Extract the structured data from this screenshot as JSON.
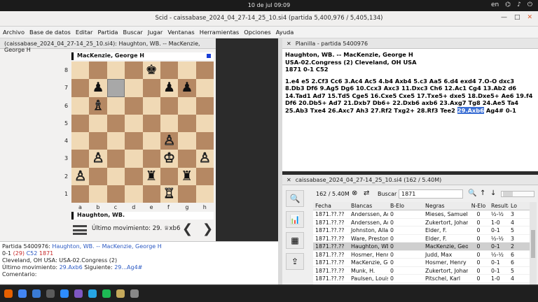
{
  "system": {
    "clock": "10 de jul  09:09",
    "lang": "en",
    "icons": [
      "network-icon",
      "volume-icon",
      "power-icon"
    ]
  },
  "window": {
    "title": "Scid - caissabase_2024_04_27-14_25_10.si4 (partida 5,400,976 / 5,405,134)"
  },
  "menu": [
    "Archivo",
    "Base de datos",
    "Editar",
    "Partida",
    "Buscar",
    "Jugar",
    "Ventanas",
    "Herramientas",
    "Opciones",
    "Ayuda"
  ],
  "board_tab": "(caissabase_2024_04_27-14_25_10.si4): Haughton, WB. -- MacKenzie, George H",
  "board": {
    "top_player": "MacKenzie, George H",
    "bottom_player": "Haughton, WB.",
    "ranks": [
      "8",
      "7",
      "6",
      "5",
      "4",
      "3",
      "2",
      "1"
    ],
    "files": [
      "a",
      "b",
      "c",
      "d",
      "e",
      "f",
      "g",
      "h"
    ],
    "last_move_label": "Último movimiento: 29. ♕xb6",
    "squares": [
      [
        "",
        "",
        "",
        "",
        "♚",
        "",
        "",
        ""
      ],
      [
        "",
        "♟",
        "",
        "",
        "",
        "♟",
        "♟",
        ""
      ],
      [
        "",
        "♗",
        "",
        "",
        "",
        "",
        "",
        ""
      ],
      [
        "",
        "",
        "",
        "",
        "",
        "",
        "",
        ""
      ],
      [
        "",
        "",
        "",
        "",
        "",
        "♙",
        "",
        ""
      ],
      [
        "",
        "♙",
        "",
        "",
        "",
        "♔",
        "",
        "♙"
      ],
      [
        "♙",
        "",
        "",
        "",
        "♜",
        "",
        "♜",
        ""
      ],
      [
        "",
        "",
        "",
        "",
        "",
        "♖",
        "",
        ""
      ]
    ],
    "white_pieces": [
      "♗",
      "♙",
      "♔",
      "♖"
    ]
  },
  "info": {
    "line1_prefix": "Partida 5400976:",
    "white": "Haughton, WB.",
    "sep": "--",
    "black": "MacKenzie, George H",
    "result": "0-1",
    "moves": "(29)",
    "eco": "C52",
    "year": "1871",
    "event": "Cleveland, OH USA:  USA-02.Congress (2)",
    "last_label": "Último movimiento:",
    "last_move": "29.Axb6",
    "next_label": "Siguiente:",
    "next_move": "29...Ag4#",
    "comment_label": "Comentario:"
  },
  "pgn_tab": "Planilla - partida 5400976",
  "pgn": {
    "header1": "Haughton, WB.   --   MacKenzie, George H",
    "header2": "USA-02.Congress (2)  Cleveland, OH USA",
    "header3": "1871  0-1  C52",
    "moves_before": "1.e4 e5 2.Cf3 Cc6 3.Ac4 Ac5 4.b4 Axb4 5.c3 Aa5 6.d4 exd4 7.O-O dxc3 8.Db3 Df6 9.Ag5 Dg6 10.Ccx3 Axc3 11.Dxc3 Ch6 12.Ac1 Cg4 13.Ab2 d6 14.Tad1 Ad7 15.Td5 Cge5 16.Cxe5 Cxe5 17.Txe5+ dxe5 18.Dxe5+ Ae6 19.f4 Df6 20.Db5+ Ad7 21.Dxb7 Db6+ 22.Dxb6 axb6 23.Axg7 Tg8 24.Ae5 Ta4 25.Ab3 Txe4 26.Axc7 Ah3 27.Rf2 Txg2+ 28.Rf3 Tee2 ",
    "current": "29.Axb6",
    "moves_after": " Ag4# 0-1"
  },
  "list_tab": "caissabase_2024_04_27-14_25_10.si4 (162 / 5.40M)",
  "filter": {
    "count": "162 / 5.40M",
    "search_label": "Buscar",
    "search_value": "1871"
  },
  "table": {
    "headers": [
      "Fecha",
      "Blancas",
      "B-Elo",
      "Negras",
      "N-Elo",
      "Resulta",
      "Lo"
    ],
    "rows": [
      [
        "1871.??.??",
        "Anderssen, Adolf",
        "0",
        "Mieses, Samuel",
        "0",
        "½-½",
        "3"
      ],
      [
        "1871.??.??",
        "Anderssen, Adolf",
        "0",
        "Zukertort, Johannes",
        "0",
        "1-0",
        "4"
      ],
      [
        "1871.??.??",
        "Johnston, Allan",
        "0",
        "Elder, F.",
        "0",
        "0-1",
        "5"
      ],
      [
        "1871.??.??",
        "Ware, Preston",
        "0",
        "Elder, F.",
        "0",
        "½-½",
        "3"
      ],
      [
        "1871.??.??",
        "Haughton, WB.",
        "0",
        "MacKenzie, George H",
        "0",
        "0-1",
        "2"
      ],
      [
        "1871.??.??",
        "Hosmer, Henry",
        "0",
        "Judd, Max",
        "0",
        "½-½",
        "6"
      ],
      [
        "1871.??.??",
        "MacKenzie, George",
        "0",
        "Hosmer, Henry",
        "0",
        "0-1",
        "6"
      ],
      [
        "1871.??.??",
        "Munk, H.",
        "0",
        "Zukertort, Johannes",
        "0",
        "0-1",
        "5"
      ],
      [
        "1871.??.??",
        "Paulsen, Louis",
        "0",
        "Pitschel, Karl",
        "0",
        "1-0",
        "4"
      ]
    ],
    "selected_index": 4
  },
  "colors": {
    "light_square": "#f0d9b5",
    "dark_square": "#b58863",
    "highlight": "#3b6fd4"
  }
}
